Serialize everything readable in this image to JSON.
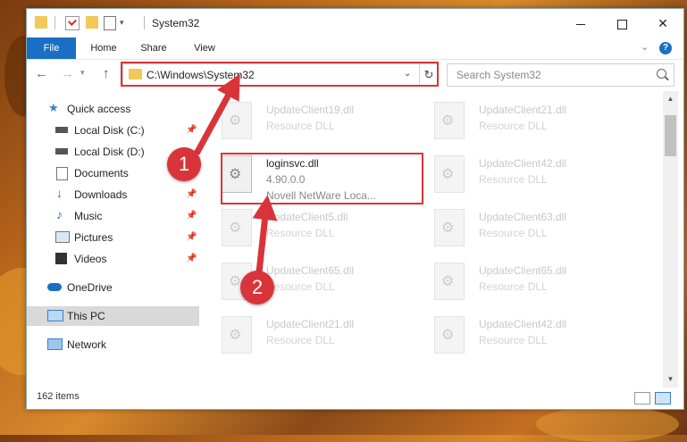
{
  "window": {
    "title": "System32"
  },
  "quick_access_toolbar": {
    "icons": [
      "folder-icon",
      "properties-check-icon",
      "new-folder-icon",
      "properties-icon",
      "customize-dropdown-icon"
    ]
  },
  "window_controls": {
    "minimize": "minimize-icon",
    "maximize": "maximize-icon",
    "close": "✕"
  },
  "ribbon": {
    "tabs": [
      {
        "label": "File",
        "active": true
      },
      {
        "label": "Home"
      },
      {
        "label": "Share"
      },
      {
        "label": "View"
      }
    ],
    "help": "?"
  },
  "navigation": {
    "back": "←",
    "forward": "→",
    "recent": "▾",
    "up": "↑"
  },
  "address_bar": {
    "path": "C:\\Windows\\System32",
    "dropdown": "⌄",
    "refresh": "↻"
  },
  "search": {
    "placeholder": "Search System32"
  },
  "nav_pane": {
    "items": [
      {
        "label": "Quick access",
        "icon": "star-icon",
        "pinned": false
      },
      {
        "label": "Local Disk (C:)",
        "icon": "drive-icon",
        "pinned": true
      },
      {
        "label": "Local Disk (D:)",
        "icon": "drive-icon",
        "pinned": false
      },
      {
        "label": "Documents",
        "icon": "documents-icon",
        "pinned": true
      },
      {
        "label": "Downloads",
        "icon": "download-icon",
        "pinned": true
      },
      {
        "label": "Music",
        "icon": "music-icon",
        "pinned": true
      },
      {
        "label": "Pictures",
        "icon": "pictures-icon",
        "pinned": true
      },
      {
        "label": "Videos",
        "icon": "videos-icon",
        "pinned": true
      },
      {
        "label": "OneDrive",
        "icon": "cloud-icon",
        "pinned": false
      },
      {
        "label": "This PC",
        "icon": "computer-icon",
        "pinned": false,
        "selected": true
      },
      {
        "label": "Network",
        "icon": "network-icon",
        "pinned": false
      }
    ]
  },
  "files": [
    {
      "name": "UpdateClient19.dll",
      "sub": "Resource DLL",
      "faded": true
    },
    {
      "name": "UpdateClient21.dll",
      "sub": "Resource DLL",
      "faded": true
    },
    {
      "name": "loginsvc.dll",
      "version": "4.90.0.0",
      "sub": "Novell NetWare Loca...",
      "faded": false
    },
    {
      "name": "UpdateClient42.dll",
      "sub": "Resource DLL",
      "faded": true
    },
    {
      "name": "UpdateClient5.dll",
      "sub": "Resource DLL",
      "faded": true
    },
    {
      "name": "UpdateClient63.dll",
      "sub": "Resource DLL",
      "faded": true
    },
    {
      "name": "UpdateClient65.dll",
      "sub": "Resource DLL",
      "faded": true
    },
    {
      "name": "UpdateClient65.dll",
      "sub": "Resource DLL",
      "faded": true
    },
    {
      "name": "UpdateClient21.dll",
      "sub": "Resource DLL",
      "faded": true
    },
    {
      "name": "UpdateClient42.dll",
      "sub": "Resource DLL",
      "faded": true
    }
  ],
  "scrollbar": {
    "up": "▲",
    "down": "▼"
  },
  "status_bar": {
    "item_count": "162 items"
  },
  "callouts": [
    {
      "number": "1"
    },
    {
      "number": "2"
    }
  ],
  "colors": {
    "accent": "#1a6fc4",
    "highlight": "#d9343a",
    "folder": "#f3c75a"
  }
}
